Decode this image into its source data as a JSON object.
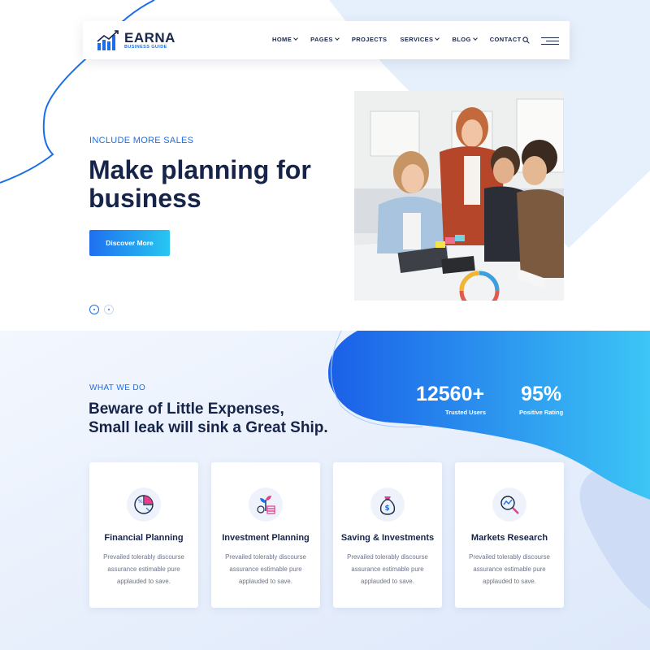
{
  "colors": {
    "accent": "#1b6ee8",
    "dark": "#17244a",
    "cyan": "#27c7f0",
    "text_muted": "#6d7488"
  },
  "brand": {
    "name": "EARNA",
    "tagline": "BUSINESS GUIDE",
    "icon": "bar-chart-logo-icon"
  },
  "nav": {
    "items": [
      {
        "label": "HOME",
        "dropdown": true
      },
      {
        "label": "PAGES",
        "dropdown": true
      },
      {
        "label": "PROJECTS",
        "dropdown": false
      },
      {
        "label": "SERVICES",
        "dropdown": true
      },
      {
        "label": "BLOG",
        "dropdown": true
      },
      {
        "label": "CONTACT",
        "dropdown": false
      }
    ],
    "search_icon": "search-icon",
    "menu_icon": "hamburger-icon"
  },
  "hero": {
    "kicker": "INCLUDE MORE SALES",
    "title_line1": "Make planning for",
    "title_line2": "business",
    "button": "Discover More",
    "slides": 2,
    "active_slide": 1
  },
  "what_we_do": {
    "kicker": "WHAT WE DO",
    "title_line1": "Beware of Little Expenses,",
    "title_line2": "Small leak will sink a Great Ship."
  },
  "stats": [
    {
      "value": "12560+",
      "label": "Trusted Users"
    },
    {
      "value": "95%",
      "label": "Positive Rating"
    }
  ],
  "services": [
    {
      "title": "Financial Planning",
      "line1": "Prevailed tolerably discourse",
      "line2": "assurance estimable pure",
      "line3": "applauded to save.",
      "icon": "pie-chart-percent-icon"
    },
    {
      "title": "Investment Planning",
      "line1": "Prevailed tolerably discourse",
      "line2": "assurance estimable pure",
      "line3": "applauded to save.",
      "icon": "plant-coins-icon"
    },
    {
      "title": "Saving & Investments",
      "line1": "Prevailed tolerably discourse",
      "line2": "assurance estimable pure",
      "line3": "applauded to save.",
      "icon": "money-bag-icon"
    },
    {
      "title": "Markets Research",
      "line1": "Prevailed tolerably discourse",
      "line2": "assurance estimable pure",
      "line3": "applauded to save.",
      "icon": "magnifier-chart-icon"
    }
  ]
}
